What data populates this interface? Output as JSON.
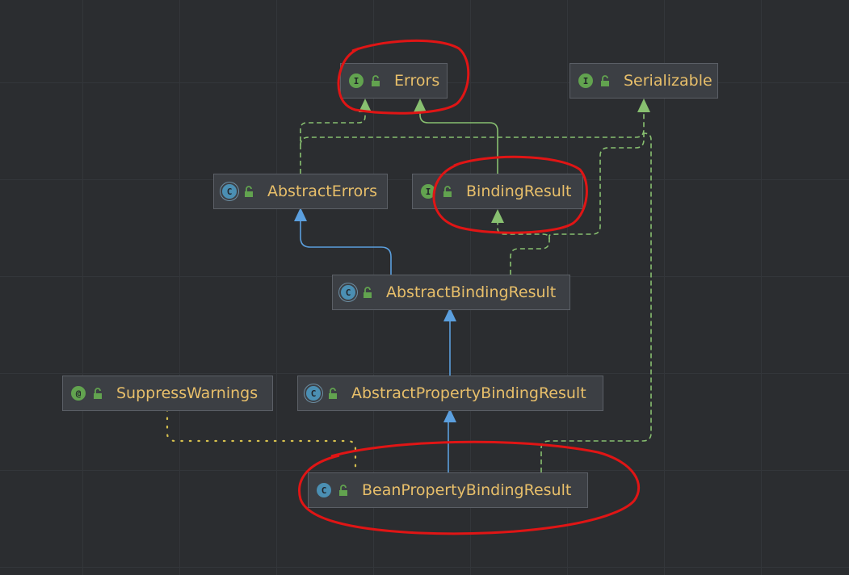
{
  "nodes": {
    "errors": {
      "name": "Errors",
      "kind": "interface",
      "badge": "I"
    },
    "serializable": {
      "name": "Serializable",
      "kind": "interface",
      "badge": "I"
    },
    "abstract_errors": {
      "name": "AbstractErrors",
      "kind": "abstract-class",
      "badge": "C"
    },
    "binding_result": {
      "name": "BindingResult",
      "kind": "interface",
      "badge": "I"
    },
    "abstract_binding_result": {
      "name": "AbstractBindingResult",
      "kind": "abstract-class",
      "badge": "C"
    },
    "suppress_warnings": {
      "name": "SuppressWarnings",
      "kind": "annotation",
      "badge": "@"
    },
    "abstract_property_binding_result": {
      "name": "AbstractPropertyBindingResult",
      "kind": "abstract-class",
      "badge": "C"
    },
    "bean_property_binding_result": {
      "name": "BeanPropertyBindingResult",
      "kind": "class",
      "badge": "C"
    }
  },
  "edges": [
    {
      "from": "AbstractErrors",
      "to": "Errors",
      "type": "implements"
    },
    {
      "from": "AbstractErrors",
      "to": "Serializable",
      "type": "implements"
    },
    {
      "from": "BindingResult",
      "to": "Errors",
      "type": "extends-interface"
    },
    {
      "from": "AbstractBindingResult",
      "to": "AbstractErrors",
      "type": "extends"
    },
    {
      "from": "AbstractBindingResult",
      "to": "BindingResult",
      "type": "implements"
    },
    {
      "from": "AbstractBindingResult",
      "to": "Serializable",
      "type": "implements"
    },
    {
      "from": "AbstractPropertyBindingResult",
      "to": "AbstractBindingResult",
      "type": "extends"
    },
    {
      "from": "BeanPropertyBindingResult",
      "to": "AbstractPropertyBindingResult",
      "type": "extends"
    },
    {
      "from": "BeanPropertyBindingResult",
      "to": "Serializable",
      "type": "implements"
    },
    {
      "from": "BeanPropertyBindingResult",
      "to": "SuppressWarnings",
      "type": "annotated-with"
    }
  ],
  "colors": {
    "background": "#2b2d30",
    "node_fill": "#3c3f44",
    "node_border": "#5b5f66",
    "label": "#e8bf6a",
    "extends_edge": "#5b9fde",
    "interface_edge": "#88c070",
    "annotation_edge": "#d6c04e",
    "highlight_annotation": "#e01515"
  },
  "annotations": {
    "highlighted": [
      "Errors",
      "BindingResult",
      "BeanPropertyBindingResult"
    ]
  }
}
